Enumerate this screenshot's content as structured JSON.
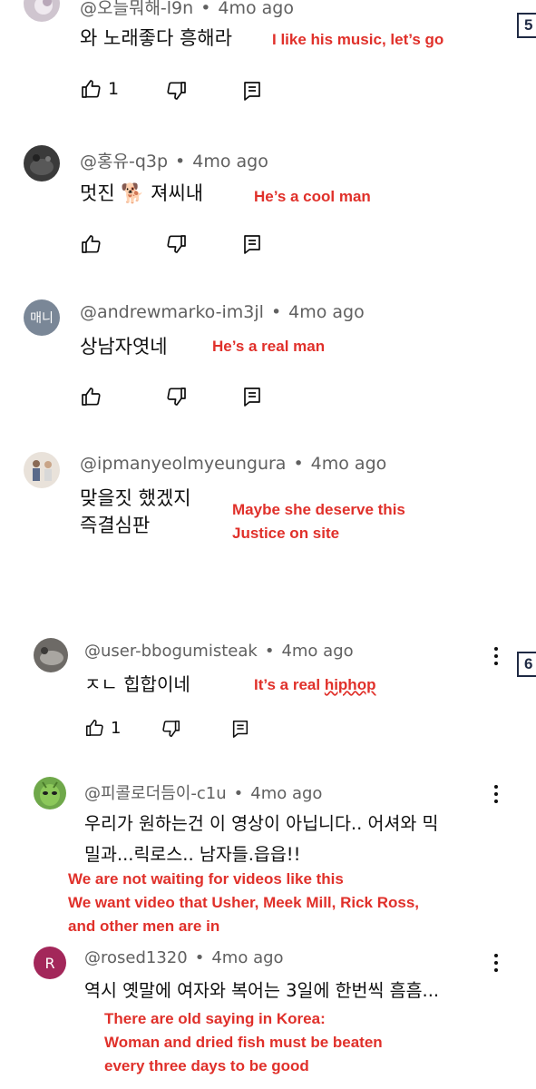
{
  "edge_markers": [
    "5",
    "6"
  ],
  "comments": [
    {
      "handle": "@오늘뭐해-l9n",
      "time": "4mo ago",
      "lines": [
        "와 노래좋다 흥해라"
      ],
      "translation": [
        "I like his music, let’s go"
      ],
      "like_count": "1",
      "avatar": {
        "kind": "photo",
        "color": "#cfc5cf"
      }
    },
    {
      "handle": "@홍유-q3p",
      "time": "4mo ago",
      "lines": [
        "멋진 🐕 져씨내"
      ],
      "translation": [
        "He’s a cool man"
      ],
      "like_count": "",
      "avatar": {
        "kind": "photo",
        "color": "#3a3a3a"
      }
    },
    {
      "handle": "@andrewmarko-im3jl",
      "time": "4mo ago",
      "lines": [
        "상남자엿네"
      ],
      "translation": [
        "He’s a real man"
      ],
      "like_count": "",
      "avatar": {
        "kind": "initials",
        "initials": "매니",
        "color": "#7a8797"
      }
    },
    {
      "handle": "@ipmanyeolmyeungura",
      "time": "4mo ago",
      "lines": [
        "맞을짓 했겠지",
        "즉결심판"
      ],
      "translation": [
        "Maybe she deserve this",
        "Justice on site"
      ],
      "like_count": "",
      "avatar": {
        "kind": "photo",
        "color": "#e9e2da"
      }
    },
    {
      "handle": "@user-bbogumisteak",
      "time": "4mo ago",
      "lines": [
        "ㅈㄴ 힙합이네"
      ],
      "translation_pre": "It’s a real ",
      "translation_underlined": "hiphop",
      "like_count": "1",
      "avatar": {
        "kind": "photo",
        "color": "#6d6a66"
      }
    },
    {
      "handle": "@피콜로더듬이-c1u",
      "time": "4mo ago",
      "lines": [
        "우리가 원하는건 이 영상이 아닙니다.. 어셔와 믹",
        "밀과...릭로스.. 남자들.읍읍!!"
      ],
      "translation": [
        "We are not waiting for videos like this",
        "We want video that Usher, Meek Mill, Rick Ross,",
        "and other men are in"
      ],
      "avatar": {
        "kind": "photo",
        "color": "#6fa84a"
      }
    },
    {
      "handle": "@rosed1320",
      "time": "4mo ago",
      "lines": [
        "역시 옛말에 여자와 복어는 3일에 한번씩 흠흠..."
      ],
      "translation": [
        "There are old saying in Korea:",
        "Woman and dried fish must be beaten",
        "every three days to be good"
      ],
      "avatar": {
        "kind": "initials",
        "initials": "R",
        "color": "#a3275a"
      }
    }
  ]
}
